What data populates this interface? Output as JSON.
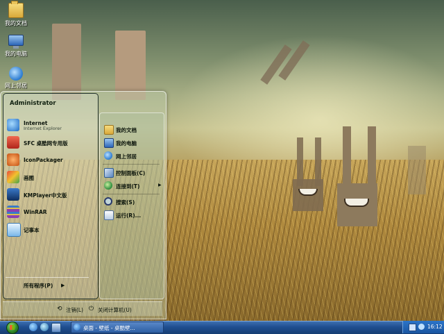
{
  "desktop": {
    "icons": [
      {
        "label": "我的文档",
        "icon": "folder-icon"
      },
      {
        "label": "我的电脑",
        "icon": "computer-icon"
      },
      {
        "label": "网上邻居",
        "icon": "network-icon"
      }
    ]
  },
  "start_menu": {
    "user": "Administrator",
    "programs": [
      {
        "name": "Internet",
        "sub": "Internet Explorer",
        "icon": "internet-explorer-icon",
        "color": "#2f7fd8"
      },
      {
        "name": "SFC 桌酷网专用版",
        "icon": "sfc-icon",
        "color": "#c43a2a"
      },
      {
        "name": "IconPackager",
        "icon": "iconpackager-icon",
        "color": "#d86a1e"
      },
      {
        "name": "画图",
        "icon": "paint-icon",
        "color": "#e0b12a"
      },
      {
        "name": "KMPlayer中文版",
        "icon": "kmplayer-icon",
        "color": "#1b4f8f"
      },
      {
        "name": "WinRAR",
        "icon": "winrar-icon",
        "color": "#7a3a9a"
      },
      {
        "name": "记事本",
        "icon": "notepad-icon",
        "color": "#5fa8e0"
      }
    ],
    "all_programs": "所有程序(P)",
    "places": [
      {
        "label": "我的文档",
        "icon": "folder-icon"
      },
      {
        "label": "我的电脑",
        "icon": "computer-icon"
      },
      {
        "label": "网上邻居",
        "icon": "network-icon"
      }
    ],
    "system": [
      {
        "label": "控制面板(C)",
        "icon": "control-panel-icon"
      },
      {
        "label": "连接到(T)",
        "icon": "connect-to-icon"
      }
    ],
    "tools": [
      {
        "label": "搜索(S)",
        "icon": "search-icon"
      },
      {
        "label": "运行(R)...",
        "icon": "run-icon"
      }
    ],
    "logoff": "注销(L)",
    "shutdown": "关闭计算机(U)"
  },
  "taskbar": {
    "start_icon": "windows-start-icon",
    "quicklaunch": [
      "internet-explorer-icon",
      "media-player-icon",
      "show-desktop-icon"
    ],
    "window": "桌面 - 壁纸 - 桌酷壁...",
    "clock": "16:12"
  },
  "colors": {
    "taskbar": "#1f4e8f",
    "start_orb": "#2f8a2a"
  }
}
